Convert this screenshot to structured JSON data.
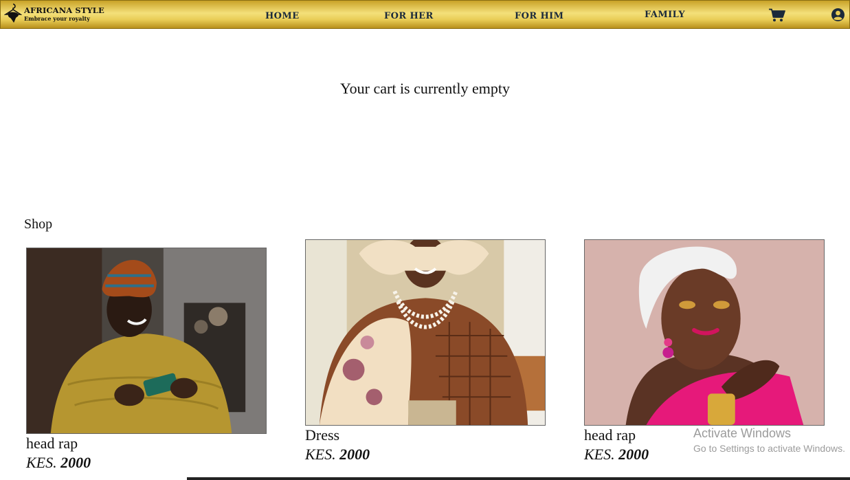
{
  "brand": {
    "name": "AFRICANA STYLE",
    "tagline": "Embrace your royalty"
  },
  "nav": {
    "home": "HOME",
    "for_her": "FOR HER",
    "for_him": "FOR HIM",
    "family": "FAMILY"
  },
  "icons": {
    "logo": "hanger-africa-logo",
    "cart": "shopping-cart-icon",
    "user": "user-circle-icon"
  },
  "colors": {
    "nav_gold": "#e8cc55",
    "nav_text": "#1b2a3a"
  },
  "cart": {
    "empty_message": "Your cart is currently empty"
  },
  "shop": {
    "heading": "Shop",
    "products": [
      {
        "title": "head rap",
        "currency": "KES.",
        "price": "2000"
      },
      {
        "title": "Dress",
        "currency": "KES.",
        "price": "2000"
      },
      {
        "title": "head rap",
        "currency": "KES.",
        "price": "2000"
      }
    ]
  },
  "watermark": {
    "line1": "Activate Windows",
    "line2": "Go to Settings to activate Windows."
  }
}
